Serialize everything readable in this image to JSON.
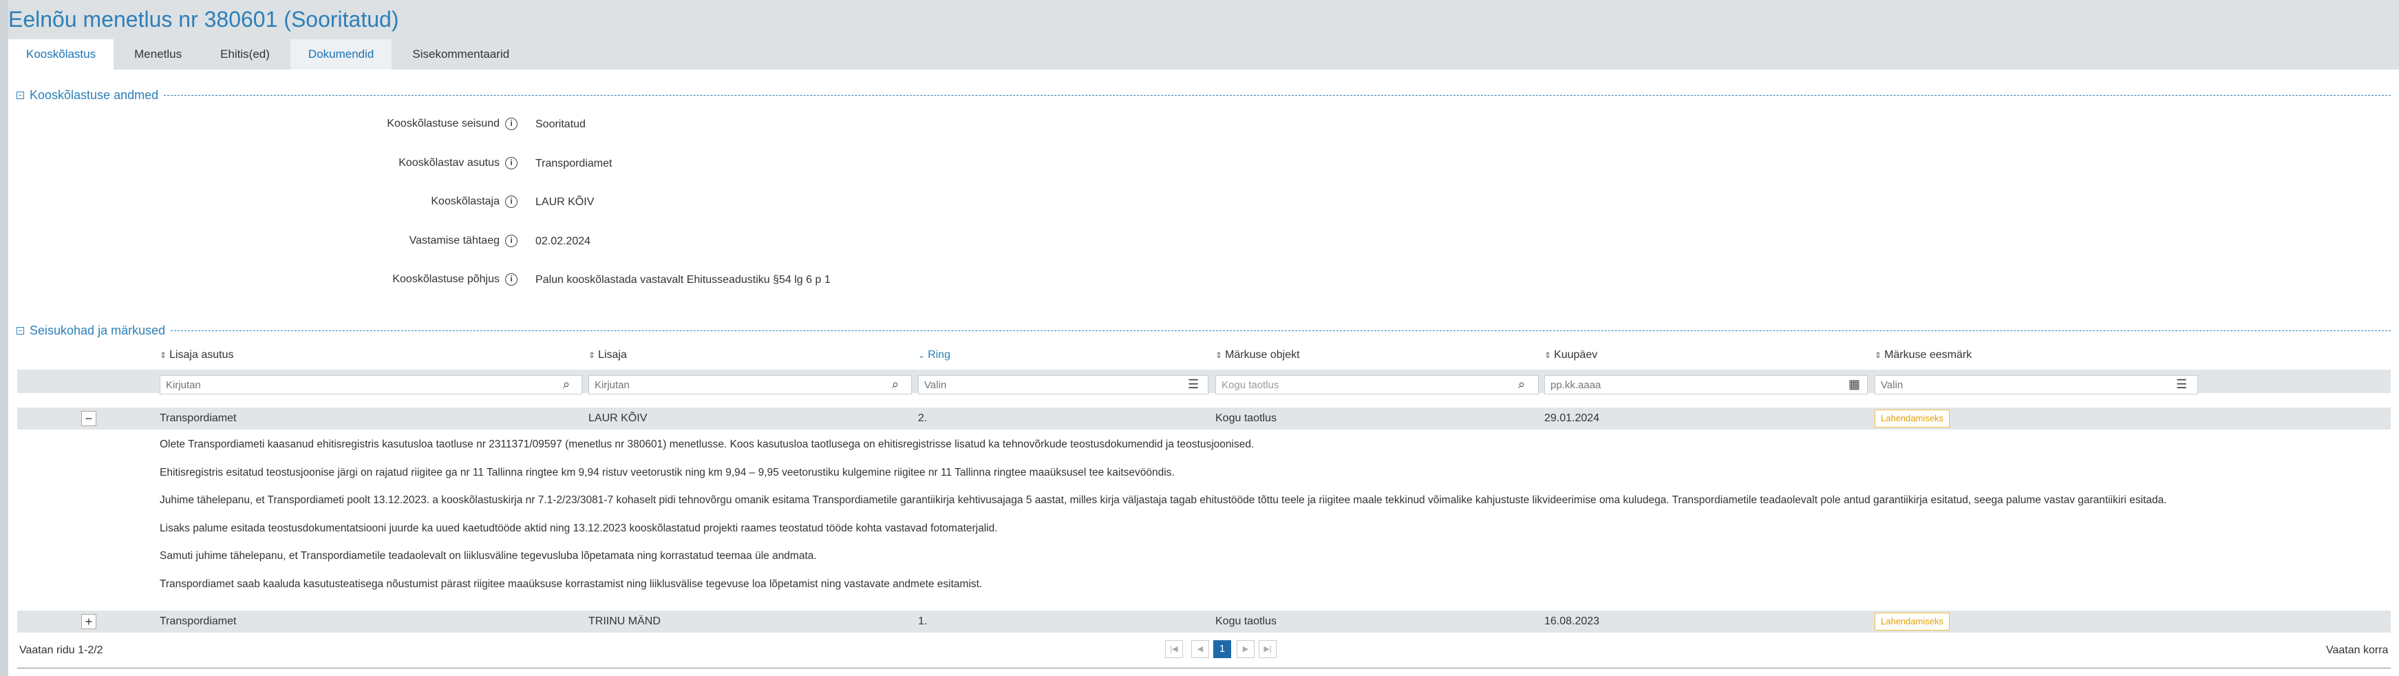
{
  "page": {
    "title": "Eelnõu menetlus nr 380601 (Sooritatud)"
  },
  "tabs": [
    {
      "label": "Kooskõlastus"
    },
    {
      "label": "Menetlus"
    },
    {
      "label": "Ehitis(ed)"
    },
    {
      "label": "Dokumendid"
    },
    {
      "label": "Sisekommentaarid"
    }
  ],
  "details_section": {
    "title": "Kooskõlastuse andmed",
    "fields": [
      {
        "label": "Kooskõlastuse seisund",
        "value": "Sooritatud"
      },
      {
        "label": "Kooskõlastav asutus",
        "value": "Transpordiamet"
      },
      {
        "label": "Kooskõlastaja",
        "value": "LAUR KÕIV"
      },
      {
        "label": "Vastamise tähtaeg",
        "value": "02.02.2024"
      },
      {
        "label": "Kooskõlastuse põhjus",
        "value": "Palun kooskõlastada vastavalt Ehitusseadustiku §54 lg 6 p 1"
      }
    ]
  },
  "remarks_section": {
    "title": "Seisukohad ja märkused",
    "columns": [
      "Lisaja asutus",
      "Lisaja",
      "Ring",
      "Märkuse objekt",
      "Kuupäev",
      "Märkuse eesmärk"
    ],
    "filters": {
      "lisaja_asutus": "Kirjutan",
      "lisaja": "Kirjutan",
      "ring": "Valin",
      "objekt": "Kogu taotlus",
      "kuupaev": "pp.kk.aaaa",
      "eesmark": "Valin"
    },
    "rows": [
      {
        "toggle": "−",
        "asutus": "Transpordiamet",
        "lisaja": "LAUR KÕIV",
        "ring": "2.",
        "objekt": "Kogu taotlus",
        "kuupaev": "29.01.2024",
        "eesmark": "Lahendamiseks",
        "comment_lines": [
          "Olete Transpordiameti kaasanud ehitisregistris kasutusloa taotluse nr 2311371/09597 (menetlus nr 380601) menetlusse. Koos kasutusloa taotlusega on ehitisregistrisse lisatud ka tehnovõrkude teostusdokumendid ja teostusjoonised.",
          "Ehitisregistris esitatud teostusjoonise järgi on rajatud riigitee ga nr 11 Tallinna ringtee km 9,94 ristuv veetorustik ning km 9,94 – 9,95 veetorustiku kulgemine riigitee nr 11 Tallinna ringtee maaüksusel tee kaitsevööndis.",
          "Juhime tähelepanu, et Transpordiameti poolt 13.12.2023. a kooskõlastuskirja nr 7.1-2/23/3081-7 kohaselt pidi tehnovõrgu omanik esitama Transpordiametile garantiikirja kehtivusajaga 5 aastat, milles kirja väljastaja tagab ehitustööde tõttu teele ja riigitee maale tekkinud võimalike kahjustuste likvideerimise oma kuludega. Transpordiametile teadaolevalt pole antud garantiikirja esitatud, seega palume vastav garantiikiri esitada.",
          "Lisaks palume esitada teostusdokumentatsiooni juurde ka uued kaetudtööde aktid ning 13.12.2023 kooskõlastatud projekti raames teostatud tööde kohta vastavad fotomaterjalid.",
          "Samuti juhime tähelepanu, et Transpordiametile teadaolevalt on liiklusväline tegevusluba lõpetamata ning korrastatud teemaa üle andmata.",
          "Transpordiamet saab kaaluda kasutusteatisega nõustumist pärast riigitee maaüksuse korrastamist ning liiklusvälise tegevuse loa lõpetamist ning vastavate andmete esitamist."
        ]
      },
      {
        "toggle": "+",
        "asutus": "Transpordiamet",
        "lisaja": "TRIINU MÄND",
        "ring": "1.",
        "objekt": "Kogu taotlus",
        "kuupaev": "16.08.2023",
        "eesmark": "Lahendamiseks"
      }
    ]
  },
  "pagination": {
    "rows_info": "Vaatan ridu 1-2/2",
    "current_page": "1",
    "right_text": "Vaatan korra"
  },
  "icons": {
    "info": "info-circle-icon",
    "search": "search-icon",
    "list": "list-icon",
    "calendar": "calendar-icon",
    "sort": "sort-icon"
  },
  "colors": {
    "accent": "#2d7fb8",
    "badge": "#f3c13a",
    "pager_active": "#1e6aa8"
  }
}
